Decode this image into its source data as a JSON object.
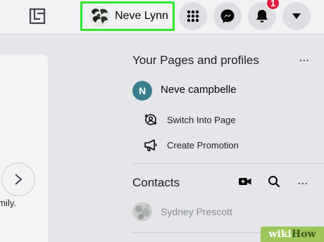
{
  "topbar": {
    "profile": {
      "name": "Neve Lynn"
    },
    "notifications": {
      "badge_count": "1"
    }
  },
  "feed": {
    "snippet_text": "amily."
  },
  "pages_panel": {
    "title": "Your Pages and profiles",
    "more_label": "...",
    "page": {
      "initial": "N",
      "name": "Neve campbelle"
    },
    "actions": [
      {
        "label": "Switch Into Page",
        "icon": "switch-profile-icon"
      },
      {
        "label": "Create Promotion",
        "icon": "megaphone-icon"
      }
    ]
  },
  "contacts": {
    "title": "Contacts",
    "more_label": "...",
    "items": [
      {
        "name": "Sydney Prescott"
      }
    ]
  },
  "watermark": {
    "part1": "wiki",
    "part2": "How"
  },
  "colors": {
    "highlight": "#2ee82e",
    "badge": "#e41e3f",
    "page_avatar": "#3a7d8c",
    "watermark": "#9ec65a"
  }
}
